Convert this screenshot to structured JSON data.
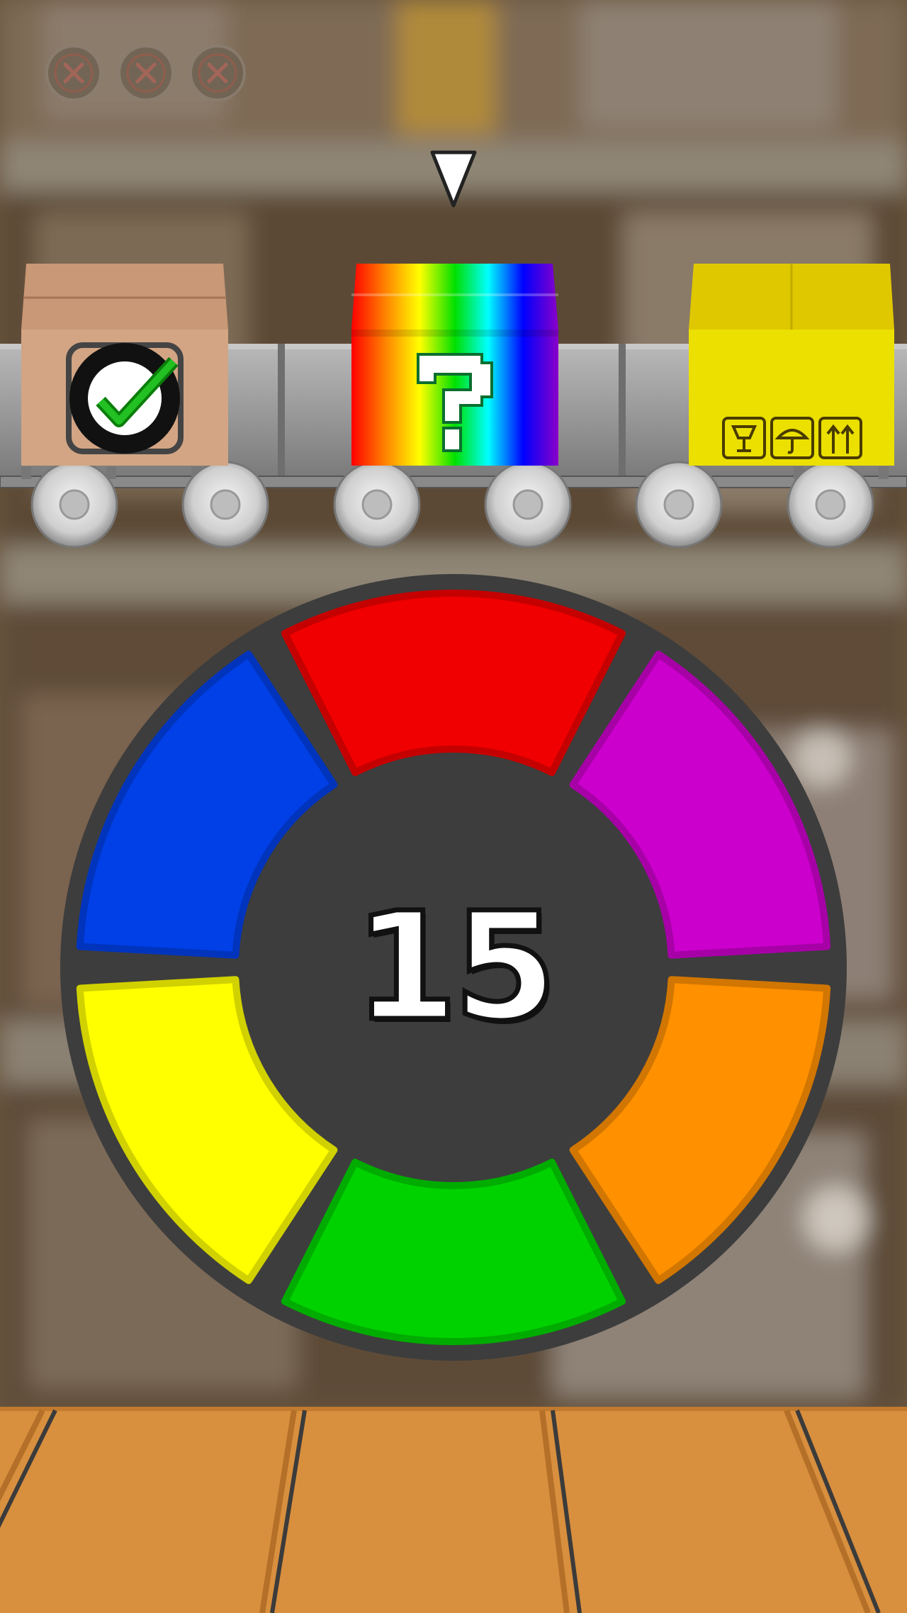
{
  "game": {
    "score": "15",
    "lives": [
      {
        "state": "empty",
        "icon": "x-circle-icon"
      },
      {
        "state": "empty",
        "icon": "x-circle-icon"
      },
      {
        "state": "empty",
        "icon": "x-circle-icon"
      }
    ],
    "pointer_icon": "down-triangle-icon"
  },
  "conveyor": {
    "boxes": [
      {
        "color": "tan",
        "hex": "#d0a07e",
        "status": "sorted",
        "icon": "checkmark-icon"
      },
      {
        "color": "rainbow",
        "status": "mystery",
        "icon": "question-mark-icon"
      },
      {
        "color": "yellow",
        "hex": "#e8dd00",
        "status": "incoming",
        "icon": "fragile-symbols-icon"
      }
    ]
  },
  "color_wheel": {
    "segments": [
      {
        "name": "red",
        "hex": "#f00000"
      },
      {
        "name": "magenta",
        "hex": "#cc00cc"
      },
      {
        "name": "orange",
        "hex": "#ff9000"
      },
      {
        "name": "green",
        "hex": "#00d200"
      },
      {
        "name": "yellow",
        "hex": "#ffff00"
      },
      {
        "name": "blue",
        "hex": "#0040e6"
      }
    ],
    "ring_hex": "#3d3d3d"
  }
}
